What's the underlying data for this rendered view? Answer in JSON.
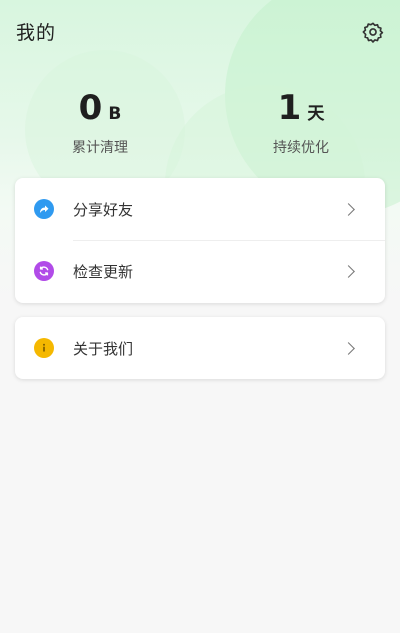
{
  "header": {
    "title": "我的",
    "settings_icon": "gear-icon"
  },
  "stats": {
    "cleaned": {
      "value": "0",
      "unit": "B",
      "label": "累计清理"
    },
    "days": {
      "value": "1",
      "unit": "天",
      "label": "持续优化"
    }
  },
  "menu": {
    "group1": [
      {
        "label": "分享好友",
        "icon": "share-icon",
        "color": "#2f9af0"
      },
      {
        "label": "检查更新",
        "icon": "refresh-icon",
        "color": "#b14be8"
      }
    ],
    "group2": [
      {
        "label": "关于我们",
        "icon": "info-icon",
        "color": "#f5b800"
      }
    ]
  }
}
